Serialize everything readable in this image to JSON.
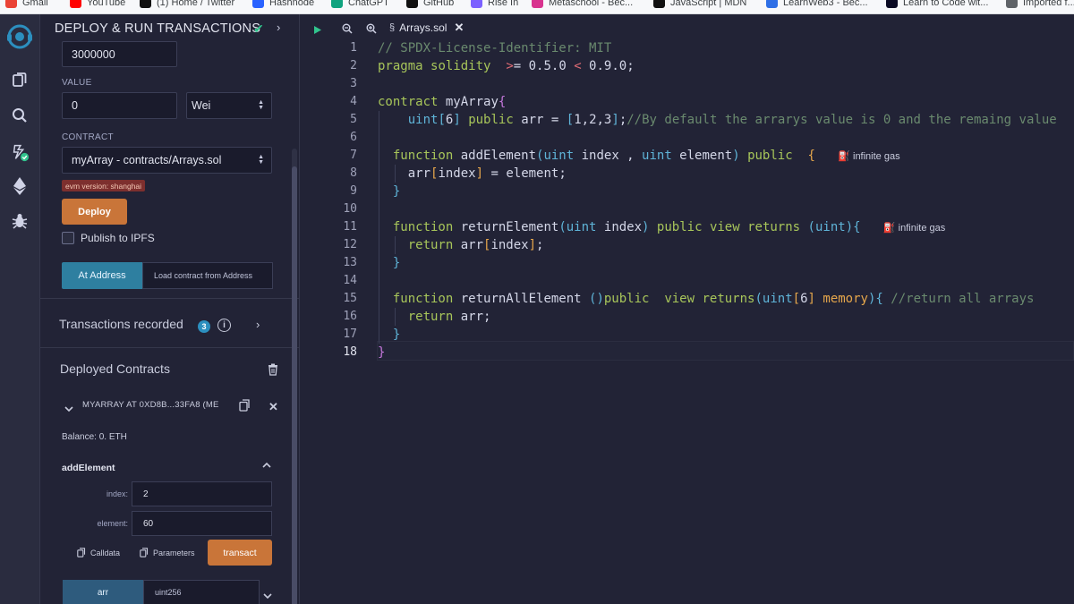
{
  "bookmarks": [
    {
      "label": "Gmail",
      "icon": "gmail-icon",
      "color": "#ea4335"
    },
    {
      "label": "YouTube",
      "icon": "youtube-icon",
      "color": "#ff0000"
    },
    {
      "label": "(1) Home / Twitter",
      "icon": "x-icon",
      "color": "#111111"
    },
    {
      "label": "Hashnode",
      "icon": "hashnode-icon",
      "color": "#2962ff"
    },
    {
      "label": "ChatGPT",
      "icon": "chatgpt-icon",
      "color": "#10a37f"
    },
    {
      "label": "GitHub",
      "icon": "github-icon",
      "color": "#111111"
    },
    {
      "label": "Rise In",
      "icon": "risein-icon",
      "color": "#7b61ff"
    },
    {
      "label": "Metaschool - Bec...",
      "icon": "metaschool-icon",
      "color": "#d8338f"
    },
    {
      "label": "JavaScript | MDN",
      "icon": "mdn-icon",
      "color": "#111111"
    },
    {
      "label": "LearnWeb3 - Bec...",
      "icon": "learnweb3-icon",
      "color": "#2e6fe6"
    },
    {
      "label": "Learn to Code wit...",
      "icon": "fcc-icon",
      "color": "#0a0a23"
    },
    {
      "label": "Imported f...",
      "icon": "folder-icon",
      "color": "#5f6368"
    }
  ],
  "panel": {
    "title": "DEPLOY & RUN TRANSACTIONS",
    "gas_limit": "3000000",
    "value_label": "VALUE",
    "value": "0",
    "unit": "Wei",
    "contract_label": "CONTRACT",
    "contract": "myArray - contracts/Arrays.sol",
    "evm_badge": "evm version: shanghai",
    "deploy_label": "Deploy",
    "publish_label": "Publish to IPFS",
    "at_address_label": "At Address",
    "load_contract_label": "Load contract from Address",
    "transactions_label": "Transactions recorded",
    "transactions_count": "3",
    "deployed_label": "Deployed Contracts",
    "deployed_contract": "MYARRAY AT 0XD8B...33FA8 (ME",
    "balance": "Balance: 0. ETH",
    "function_name": "addElement",
    "params": [
      {
        "label": "index:",
        "value": "2"
      },
      {
        "label": "element:",
        "value": "60"
      }
    ],
    "calldata_label": "Calldata",
    "parameters_label": "Parameters",
    "transact_label": "transact",
    "arr_label": "arr",
    "arr_placeholder": "uint256"
  },
  "editor": {
    "tab_label": "Arrays.sol",
    "line_numbers": [
      "1",
      "2",
      "3",
      "4",
      "5",
      "6",
      "7",
      "8",
      "9",
      "10",
      "11",
      "12",
      "13",
      "14",
      "15",
      "16",
      "17",
      "18"
    ],
    "gas_hint": "infinite gas",
    "line1": "// SPDX-License-Identifier: MIT",
    "line5_comment": "//By default the arrarys value is 0 and the remaing value",
    "line15_comment": "//return all arrays"
  },
  "colors": {
    "accent_orange": "#c97539",
    "accent_blue": "#2e7fa0",
    "check_green": "#31c48d"
  }
}
